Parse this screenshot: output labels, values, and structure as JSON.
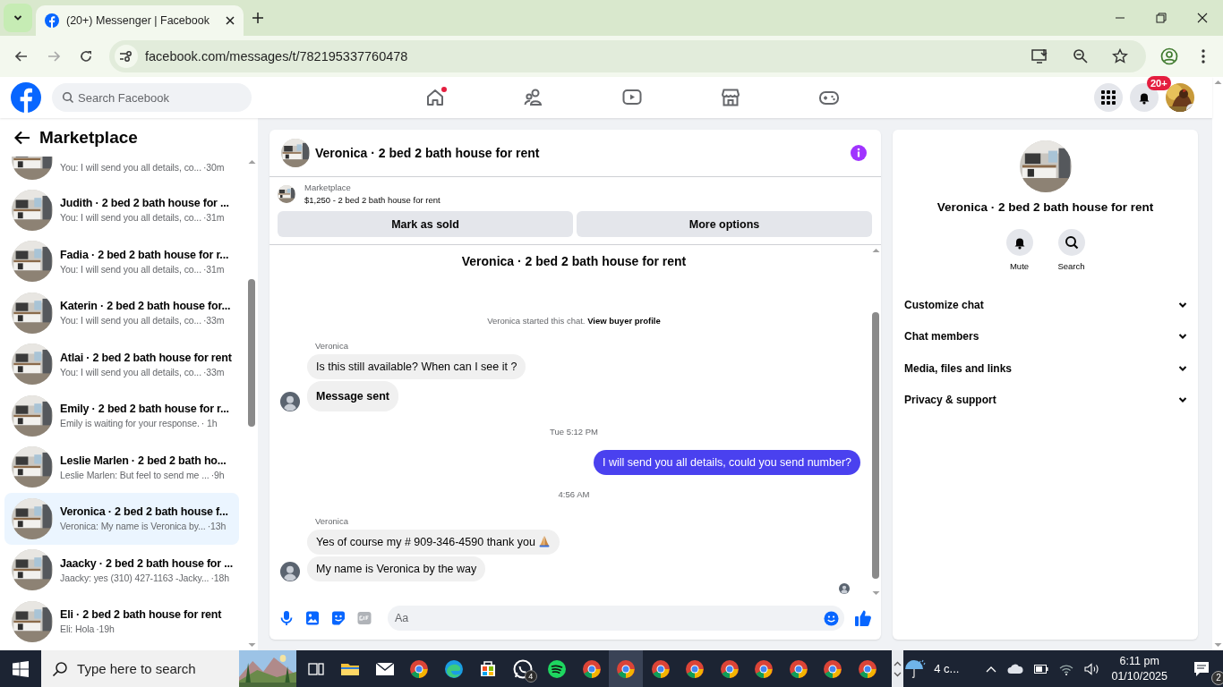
{
  "browser": {
    "tab_title": "(20+) Messenger | Facebook",
    "url": "facebook.com/messages/t/782195337760478"
  },
  "header": {
    "search_placeholder": "Search Facebook",
    "notification_count": "20+",
    "nav": [
      {
        "kind": "home",
        "dot": true,
        "selected": false
      },
      {
        "kind": "friends",
        "dot": false,
        "selected": false
      },
      {
        "kind": "video",
        "dot": false,
        "selected": false
      },
      {
        "kind": "marketplace",
        "dot": false,
        "selected": false
      },
      {
        "kind": "gaming",
        "dot": false,
        "selected": false
      }
    ]
  },
  "sidebar": {
    "title": "Marketplace",
    "conversations": [
      {
        "preview": "You: I will send you all details, co...",
        "time": "·30m",
        "selected": false
      },
      {
        "title": "Judith · 2 bed 2 bath house for ...",
        "preview": "You: I will send you all details, co...",
        "time": "·31m",
        "selected": false
      },
      {
        "title": "Fadia · 2 bed 2 bath house for r...",
        "preview": "You: I will send you all details, co...",
        "time": "·31m",
        "selected": false
      },
      {
        "title": "Katerin · 2 bed 2 bath house for...",
        "preview": "You: I will send you all details, co...",
        "time": "·33m",
        "selected": false
      },
      {
        "title": "Atlai · 2 bed 2 bath house for rent",
        "preview": "You: I will send you all details, co...",
        "time": "·33m",
        "selected": false
      },
      {
        "title": "Emily · 2 bed 2 bath house for r...",
        "preview": "Emily is waiting for your response.",
        "time": "· 1h",
        "selected": false
      },
      {
        "title": "Leslie Marlen · 2 bed 2 bath ho...",
        "preview": "Leslie Marlen: But feel to send me ...",
        "time": "·9h",
        "selected": false
      },
      {
        "title": "Veronica · 2 bed 2 bath house f...",
        "preview": "Veronica: My name is Veronica by...",
        "time": "·13h",
        "selected": true
      },
      {
        "title": "Jaacky · 2 bed 2 bath house for ...",
        "preview": "Jaacky: yes (310) 427-1163 -Jacky...",
        "time": "·18h",
        "selected": false
      },
      {
        "title": "Eli · 2 bed 2 bath house for rent",
        "preview": "Eli: Hola",
        "time": "·19h",
        "selected": false
      }
    ]
  },
  "chat": {
    "title": "Veronica · 2 bed 2 bath house for rent",
    "listing": {
      "label": "Marketplace",
      "text": "$1,250 - 2 bed 2 bath house for rent"
    },
    "buttons": [
      "Mark as sold",
      "More options"
    ],
    "thread_title": "Veronica · 2 bed 2 bath house for rent",
    "note": {
      "text": "Veronica started this chat.",
      "link": "View buyer profile"
    },
    "messages": [
      {
        "kind": "sender",
        "text": "Veronica"
      },
      {
        "kind": "incoming",
        "text": "Is this still available? When can I see it ?",
        "avatar": false
      },
      {
        "kind": "status",
        "text": "Message sent",
        "avatar": true
      },
      {
        "kind": "time",
        "text": "Tue 5:12 PM"
      },
      {
        "kind": "outgoing",
        "text": "I will send you all details, could you send number?"
      },
      {
        "kind": "time",
        "text": "4:56 AM"
      },
      {
        "kind": "sender",
        "text": "Veronica"
      },
      {
        "kind": "praying",
        "text": "Yes of course my # 909-346-4590 thank you",
        "avatar": false
      },
      {
        "kind": "incoming",
        "text": "My name is Veronica by the way",
        "avatar": true
      }
    ],
    "composer_placeholder": "Aa"
  },
  "info": {
    "title": "Veronica · 2 bed 2 bath house for rent",
    "actions": [
      {
        "kind": "mute",
        "label": "Mute"
      },
      {
        "kind": "search",
        "label": "Search"
      }
    ],
    "sections": [
      "Customize chat",
      "Chat members",
      "Media, files and links",
      "Privacy & support"
    ]
  },
  "taskbar": {
    "search_placeholder": "Type here to search",
    "apps": [
      {
        "kind": "taskview",
        "selected": false
      },
      {
        "kind": "explorer",
        "selected": false
      },
      {
        "kind": "mail",
        "selected": false
      },
      {
        "kind": "chrome",
        "selected": false
      },
      {
        "kind": "edge",
        "selected": false
      },
      {
        "kind": "store",
        "selected": false
      },
      {
        "kind": "whatsapp",
        "badge": "4",
        "selected": false
      },
      {
        "kind": "spotify",
        "selected": false
      },
      {
        "kind": "chrome",
        "selected": false
      },
      {
        "kind": "chrome",
        "selected": true
      },
      {
        "kind": "chrome",
        "selected": false
      },
      {
        "kind": "chrome",
        "selected": false
      },
      {
        "kind": "chrome",
        "selected": false
      },
      {
        "kind": "chrome",
        "selected": false
      },
      {
        "kind": "chrome",
        "selected": false
      },
      {
        "kind": "chrome",
        "selected": false
      },
      {
        "kind": "chrome",
        "selected": false
      }
    ],
    "weather": "4 c...",
    "time": "6:11 pm",
    "date": "01/10/2025",
    "notifications": "2"
  }
}
